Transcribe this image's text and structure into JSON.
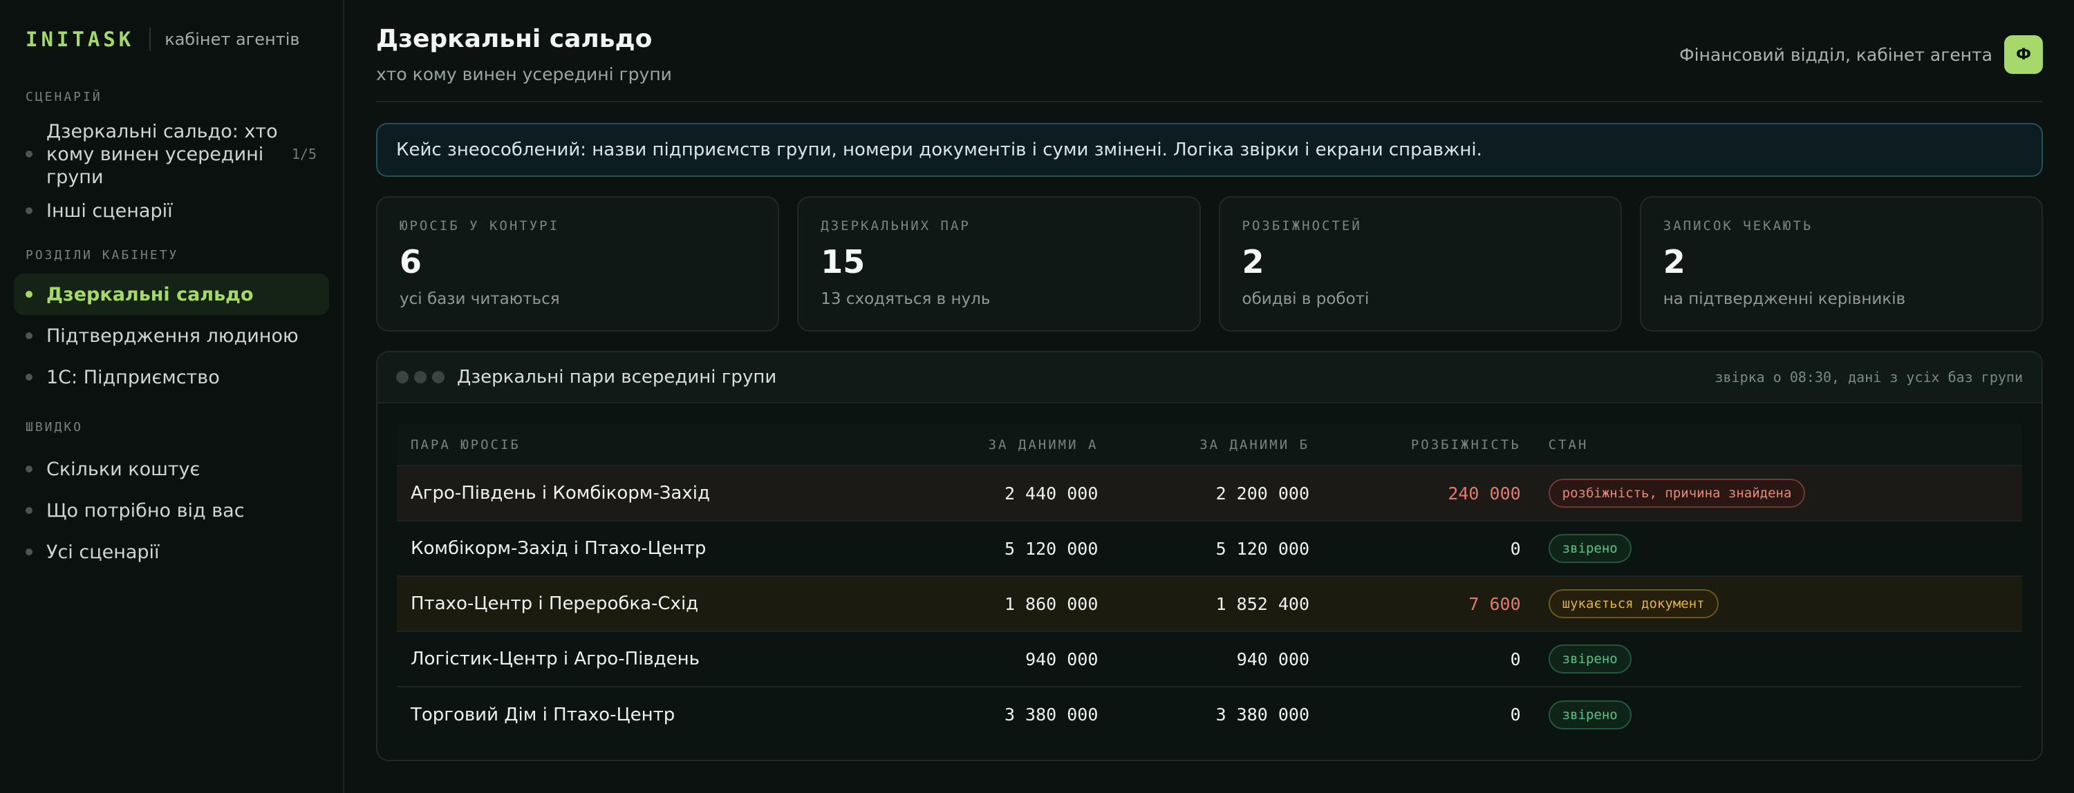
{
  "brand": {
    "logo": "INITASK",
    "subtitle": "кабінет агентів"
  },
  "sidebar": {
    "sections": [
      {
        "label": "СЦЕНАРІЙ",
        "items": [
          {
            "label": "Дзеркальні сальдо: хто кому винен усередині групи",
            "count": "1/5"
          },
          {
            "label": "Інші сценарії"
          }
        ]
      },
      {
        "label": "РОЗДІЛИ КАБІНЕТУ",
        "items": [
          {
            "label": "Дзеркальні сальдо",
            "active": true
          },
          {
            "label": "Підтвердження людиною"
          },
          {
            "label": "1С: Підприємство"
          }
        ]
      },
      {
        "label": "ШВИДКО",
        "items": [
          {
            "label": "Скільки коштує"
          },
          {
            "label": "Що потрібно від вас"
          },
          {
            "label": "Усі сценарії"
          }
        ]
      }
    ]
  },
  "header": {
    "title": "Дзеркальні сальдо",
    "subtitle": "хто кому винен усередині групи",
    "org": "Фінансовий відділ, кабінет агента",
    "avatar": "Ф"
  },
  "notice": "Кейс знеособлений: назви підприємств групи, номери документів і суми змінені. Логіка звірки і екрани справжні.",
  "stats": [
    {
      "label": "ЮРОСІБ У КОНТУРІ",
      "value": "6",
      "note": "усі бази читаються"
    },
    {
      "label": "ДЗЕРКАЛЬНИХ ПАР",
      "value": "15",
      "note": "13 сходяться в нуль"
    },
    {
      "label": "РОЗБІЖНОСТЕЙ",
      "value": "2",
      "note": "обидві в роботі"
    },
    {
      "label": "ЗАПИСОК ЧЕКАЮТЬ",
      "value": "2",
      "note": "на підтвердженні керівників"
    }
  ],
  "panel": {
    "title": "Дзеркальні пари всередині групи",
    "meta": "звірка о 08:30, дані з усіх баз групи",
    "columns": [
      "ПАРА ЮРОСІБ",
      "ЗА ДАНИМИ А",
      "ЗА ДАНИМИ Б",
      "РОЗБІЖНІСТЬ",
      "СТАН"
    ],
    "rows": [
      {
        "pair": "Агро-Південь і Комбікорм-Захід",
        "a": "2 440 000",
        "b": "2 200 000",
        "diff": "240 000",
        "status": "розбіжність, причина знайдена",
        "tone": "red"
      },
      {
        "pair": "Комбікорм-Захід і Птахо-Центр",
        "a": "5 120 000",
        "b": "5 120 000",
        "diff": "0",
        "status": "звірено",
        "tone": "green"
      },
      {
        "pair": "Птахо-Центр і Переробка-Схід",
        "a": "1 860 000",
        "b": "1 852 400",
        "diff": "7 600",
        "status": "шукається документ",
        "tone": "yellow"
      },
      {
        "pair": "Логістик-Центр і Агро-Південь",
        "a": "940 000",
        "b": "940 000",
        "diff": "0",
        "status": "звірено",
        "tone": "green"
      },
      {
        "pair": "Торговий Дім і Птахо-Центр",
        "a": "3 380 000",
        "b": "3 380 000",
        "diff": "0",
        "status": "звірено",
        "tone": "green"
      }
    ]
  }
}
